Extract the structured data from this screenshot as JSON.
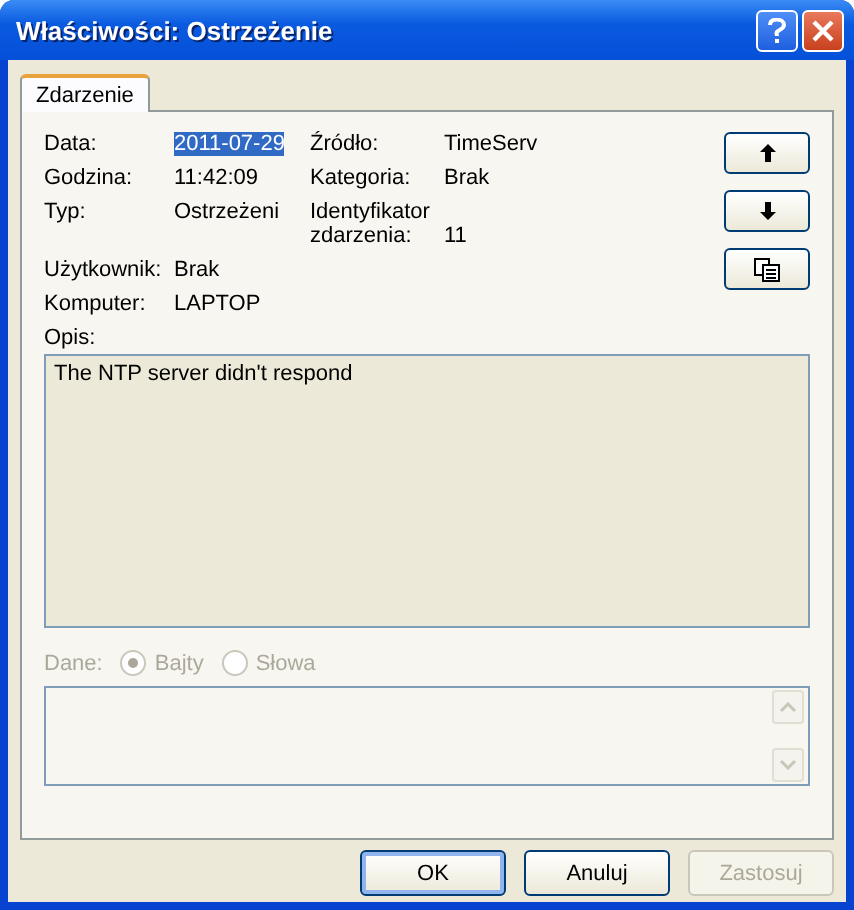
{
  "window": {
    "title": "Właściwości: Ostrzeżenie"
  },
  "tabs": [
    {
      "label": "Zdarzenie",
      "selected": true
    }
  ],
  "field_rows": [
    [
      {
        "label": "Data:",
        "value": "2011-07-29",
        "highlighted": true
      },
      {
        "label": "Źródło:",
        "value": "TimeServ",
        "highlighted": false
      }
    ],
    [
      {
        "label": "Godzina:",
        "value": "11:42:09",
        "highlighted": false
      },
      {
        "label": "Kategoria:",
        "value": "Brak",
        "highlighted": false
      }
    ],
    [
      {
        "label": "Typ:",
        "value": "Ostrzeżeni",
        "highlighted": false
      },
      {
        "label": "Identyfikator zdarzenia:",
        "value": "11",
        "highlighted": false
      }
    ],
    [
      {
        "label": "Użytkownik:",
        "value": "Brak",
        "highlighted": false
      }
    ],
    [
      {
        "label": "Komputer:",
        "value": "LAPTOP",
        "highlighted": false
      }
    ]
  ],
  "nav_buttons": [
    {
      "kind": "up"
    },
    {
      "kind": "down"
    },
    {
      "kind": "copy"
    }
  ],
  "description": {
    "label": "Opis:",
    "value": "The NTP server didn't respond"
  },
  "data": {
    "label": "Dane:",
    "disabled": true,
    "options": [
      {
        "label": "Bajty",
        "selected": true
      },
      {
        "label": "Słowa",
        "selected": false
      }
    ]
  },
  "buttons": [
    {
      "label": "OK",
      "default": true,
      "disabled": false
    },
    {
      "label": "Anuluj",
      "default": false,
      "disabled": false
    },
    {
      "label": "Zastosuj",
      "default": false,
      "disabled": true
    }
  ]
}
